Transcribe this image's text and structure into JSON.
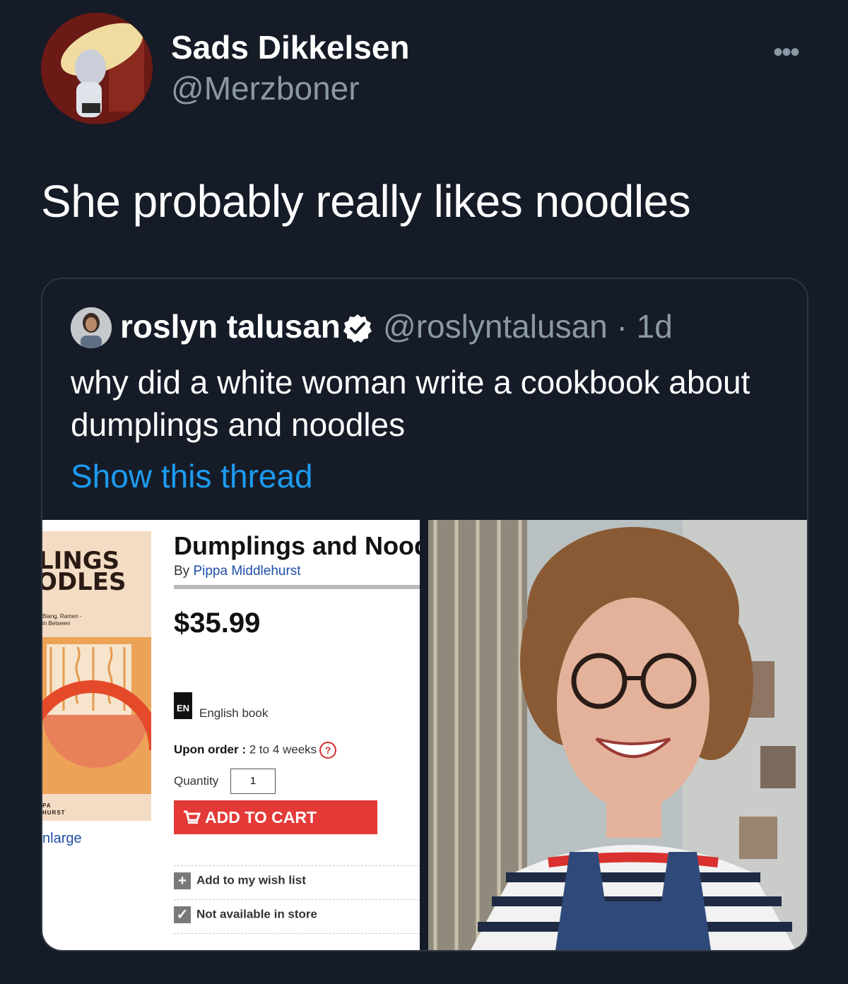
{
  "tweet": {
    "display_name": "Sads Dikkelsen",
    "handle": "@Merzboner",
    "more_icon": "more-horizontal-icon",
    "text": "She probably really likes noodles"
  },
  "quoted": {
    "display_name": "roslyn talusan",
    "verified_icon": "verified-badge-icon",
    "meta": "@roslyntalusan · 1d",
    "text": "why did a white woman write a cookbook about dumplings and noodles",
    "show_thread": "Show this thread",
    "link_color": "#1d9bf0"
  },
  "product": {
    "cover_title_1": "LINGS",
    "cover_title_2": "ODLES",
    "cover_subtitle_1": "Biang, Ramen -",
    "cover_subtitle_2": "in Between",
    "cover_author_1": "PA",
    "cover_author_2": "HURST",
    "enlarge": "nlarge",
    "title": "Dumplings and Nood",
    "by_prefix": "By",
    "author": "Pippa Middlehurst",
    "price": "$35.99",
    "lang_badge": "EN",
    "lang_label": "English book",
    "order_label": "Upon order :",
    "order_value": "2 to 4 weeks",
    "help_glyph": "?",
    "qty_label": "Quantity",
    "qty_value": "1",
    "add_to_cart": "ADD TO CART",
    "wishlist": "Add to my wish list",
    "store": "Not available in store",
    "button_color": "#e33a38"
  }
}
